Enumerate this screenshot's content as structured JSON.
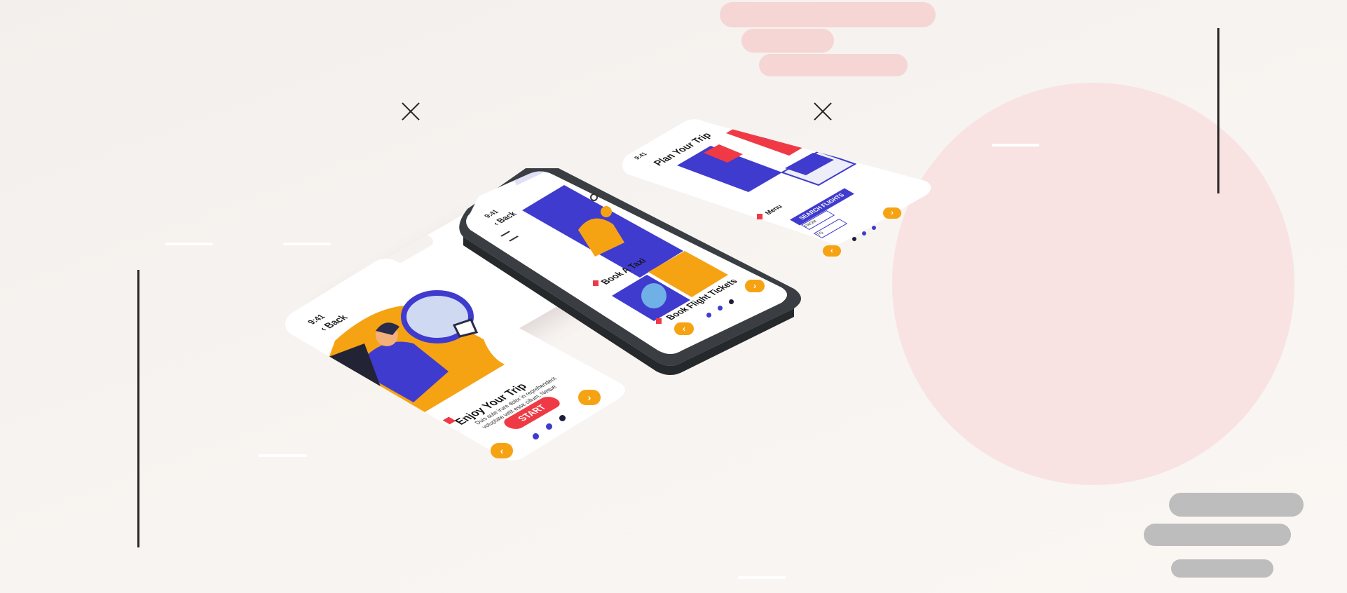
{
  "colors": {
    "accent_orange": "#f6a313",
    "accent_red": "#ef3a45",
    "accent_blue": "#3f3bcf",
    "soft_pink": "#f8e3e2",
    "cloud_pink": "#f5d6d5",
    "cloud_gray": "#bdbdbd"
  },
  "screen_left": {
    "status_time": "9:41",
    "back_label": "Back",
    "title": "Enjoy Your Trip",
    "description": "Duis aute irure dolor in reprehenderit voluptate velit esse cillum. Neque",
    "start_label": "START",
    "back_icon": "chevron-left-icon",
    "next_icon": "chevron-right-icon",
    "prev_icon": "chevron-left-icon"
  },
  "screen_center": {
    "status_time": "9:41",
    "back_label": "Back",
    "item1_label": "Book A Taxi",
    "item2_label": "Book Flight Tickets",
    "search_icon": "search-icon",
    "menu_icon": "hamburger-icon"
  },
  "screen_right": {
    "status_time": "9:41",
    "title": "Plan Your Trip",
    "menu_label": "Menu",
    "search_button": "SEARCH FLIGHTS",
    "from_label": "FROM",
    "to_label": "TO"
  }
}
